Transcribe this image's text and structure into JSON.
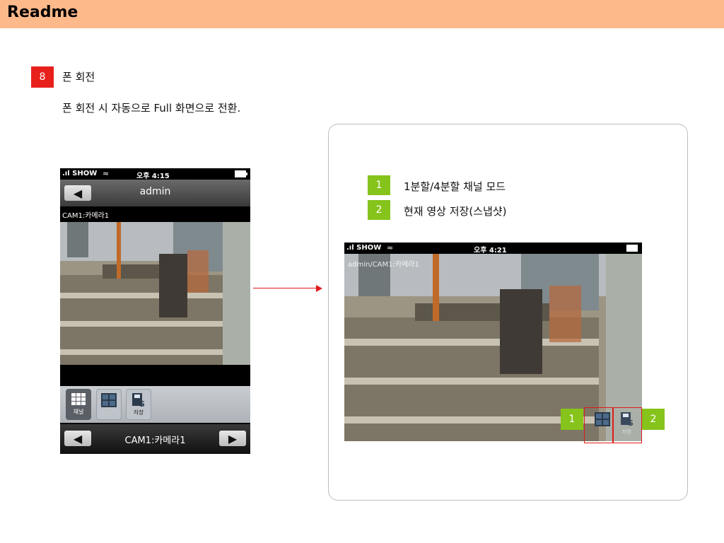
{
  "header": {
    "title": "Readme"
  },
  "section": {
    "number": "8",
    "title": "폰 회전",
    "description": "폰 회전 시 자동으로 Full 화면으로 전환."
  },
  "legend": [
    {
      "number": "1",
      "text": "1분할/4분할 채널 모드"
    },
    {
      "number": "2",
      "text": "현재 영상 저장(스냅샷)"
    }
  ],
  "portrait_phone": {
    "status": {
      "carrier": ".ıl SHOW",
      "time": "오후 4:15"
    },
    "nav_title": "admin",
    "camera_label": "CAM1:카메라1",
    "toolbar": {
      "channel_label": "채널",
      "save_label": "저장"
    },
    "bottom_title": "CAM1:카메라1"
  },
  "landscape_phone": {
    "status": {
      "carrier": ".ıl SHOW",
      "time": "오후 4:21"
    },
    "caption": "admin/CAM1:카메라1",
    "save_label": "저장",
    "markers": [
      "1",
      "2"
    ]
  },
  "colors": {
    "header_bg": "#fdb98a",
    "badge_red": "#e8201c",
    "badge_green": "#86c31b",
    "arrow": "#e01a1a"
  },
  "icons": [
    "back-arrow-icon",
    "forward-arrow-icon",
    "grid-9-icon",
    "grid-4-icon",
    "save-disk-icon",
    "wifi-icon",
    "battery-icon"
  ]
}
